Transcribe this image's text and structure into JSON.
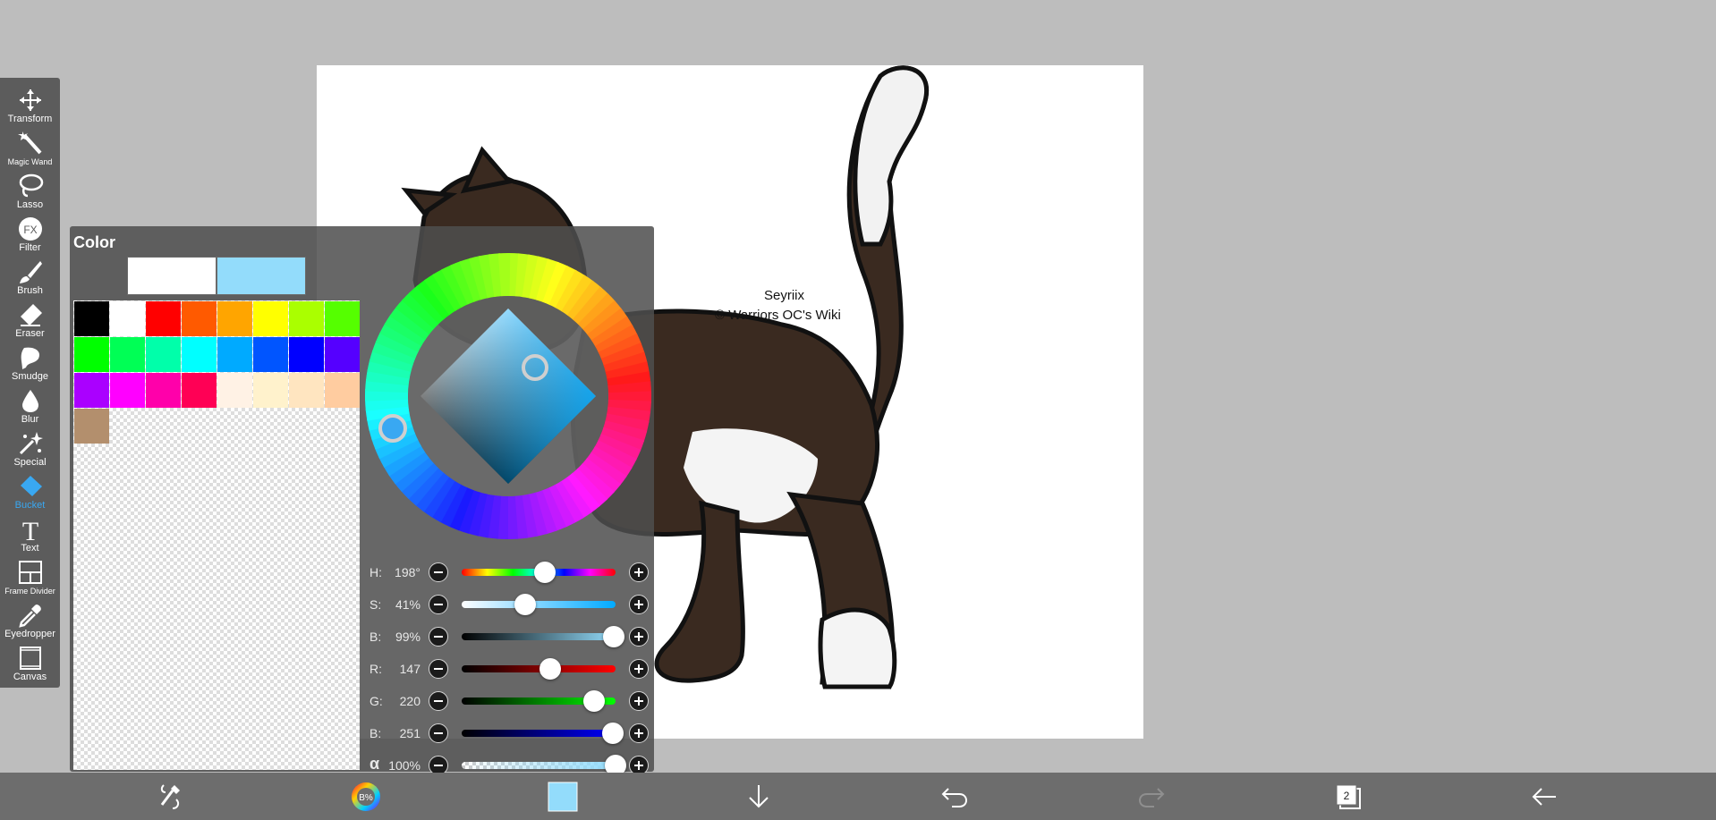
{
  "toolbar": {
    "tools": [
      {
        "label": "Transform",
        "icon": "transform-icon"
      },
      {
        "label": "Magic Wand",
        "icon": "magic-wand-icon"
      },
      {
        "label": "Lasso",
        "icon": "lasso-icon"
      },
      {
        "label": "Filter",
        "icon": "fx-icon",
        "badge": "FX"
      },
      {
        "label": "Brush",
        "icon": "brush-icon"
      },
      {
        "label": "Eraser",
        "icon": "eraser-icon"
      },
      {
        "label": "Smudge",
        "icon": "smudge-icon"
      },
      {
        "label": "Blur",
        "icon": "blur-drop-icon"
      },
      {
        "label": "Special",
        "icon": "special-sparkle-icon"
      },
      {
        "label": "Bucket",
        "icon": "bucket-icon"
      },
      {
        "label": "Text",
        "icon": "text-icon",
        "badge": "T"
      },
      {
        "label": "Frame Divider",
        "icon": "frame-divider-icon"
      },
      {
        "label": "Eyedropper",
        "icon": "eyedropper-icon"
      },
      {
        "label": "Canvas",
        "icon": "canvas-icon"
      }
    ],
    "active": "Bucket",
    "active_color": "#39a8f2"
  },
  "color_panel": {
    "title": "Color",
    "previous_color": "#ffffff",
    "current_color": "#93dcfb",
    "palette": [
      "#000000",
      "#ffffff",
      "#ff0000",
      "#ff5a00",
      "#ffa500",
      "#ffff00",
      "#aaff00",
      "#55ff00",
      "#00ff00",
      "#00ff55",
      "#00ffaa",
      "#00ffff",
      "#00aaff",
      "#0055ff",
      "#0000ff",
      "#5500ff",
      "#aa00ff",
      "#ff00ff",
      "#ff00aa",
      "#ff0055",
      "#fff2e5",
      "#fff2cc",
      "#ffe5c0",
      "#ffcca0",
      "#b38f6d"
    ],
    "sliders": [
      {
        "label": "H:",
        "value": "198°",
        "fraction": 0.54
      },
      {
        "label": "S:",
        "value": "41%",
        "fraction": 0.41
      },
      {
        "label": "B:",
        "value": "99%",
        "fraction": 0.99
      },
      {
        "label": "R:",
        "value": "147",
        "fraction": 0.576
      },
      {
        "label": "G:",
        "value": "220",
        "fraction": 0.863
      },
      {
        "label": "B:",
        "value": "251",
        "fraction": 0.984
      },
      {
        "label": "α",
        "value": "100%",
        "fraction": 1.0
      }
    ]
  },
  "artwork": {
    "watermark_line1": "Seyriix",
    "watermark_line2": "© Warriors OC's Wiki"
  },
  "bottombar": {
    "items": [
      {
        "name": "tool-swap-icon"
      },
      {
        "name": "color-wheel-icon",
        "badge": "B%"
      },
      {
        "name": "current-color-swatch",
        "color": "#93dcfb"
      },
      {
        "name": "download-arrow-icon"
      },
      {
        "name": "undo-icon"
      },
      {
        "name": "redo-icon"
      },
      {
        "name": "layers-icon",
        "badge": "2"
      },
      {
        "name": "back-arrow-icon"
      }
    ]
  }
}
